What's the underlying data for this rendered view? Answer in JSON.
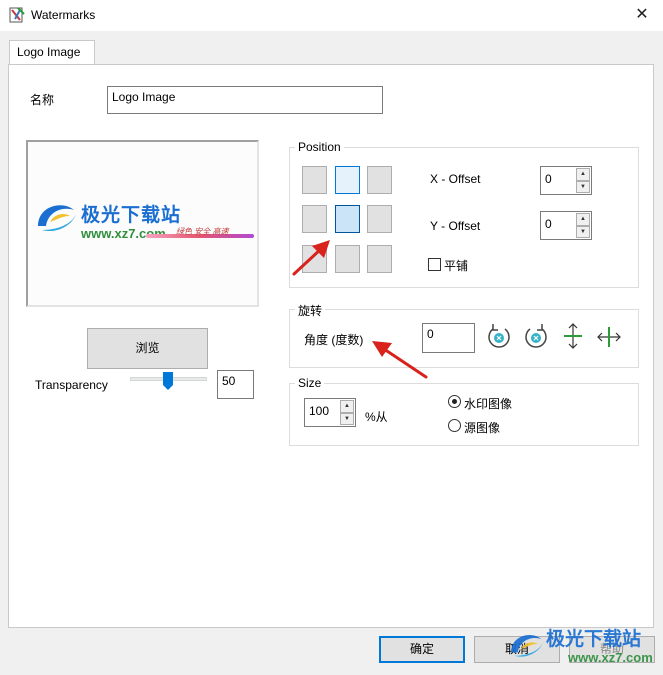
{
  "window": {
    "title": "Watermarks",
    "close_glyph": "✕"
  },
  "tab": {
    "label": "Logo Image"
  },
  "name_field": {
    "label": "名称",
    "value": "Logo Image"
  },
  "preview": {
    "brand_cn": "极光下载站",
    "brand_url": "www.xz7.com",
    "brand_tagline": "绿色 安全 高速"
  },
  "browse_button": "浏览",
  "transparency": {
    "label": "Transparency",
    "value": "50",
    "level_percent": 50
  },
  "position": {
    "title": "Position",
    "x_label": "X - Offset",
    "x_value": "0",
    "y_label": "Y - Offset",
    "y_value": "0",
    "tile_label": "平铺",
    "selected_cell": "middle-center"
  },
  "rotate": {
    "title": "旋转",
    "angle_label": "角度 (度数)",
    "angle_value": "0"
  },
  "size": {
    "title": "Size",
    "value": "100",
    "unit_label": "%从",
    "option_watermark": "水印图像",
    "option_source": "源图像"
  },
  "footer": {
    "ok": "确定",
    "cancel": "取消",
    "help": "帮助"
  },
  "overlay_watermark": {
    "brand_cn": "极光下载站",
    "brand_url": "www.xz7.com"
  },
  "colors": {
    "accent": "#0078d7",
    "arrow": "#d9221c",
    "brand_blue": "#1a6fd1"
  }
}
